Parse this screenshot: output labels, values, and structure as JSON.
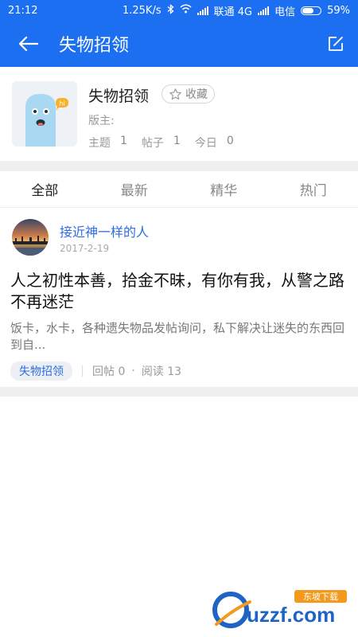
{
  "status_bar": {
    "time": "21:12",
    "speed": "1.25K/s",
    "carrier1": "联通 4G",
    "carrier2": "电信",
    "battery": "59%"
  },
  "app_bar": {
    "title": "失物招领",
    "back_icon": "back-arrow-icon",
    "edit_icon": "edit-post-icon"
  },
  "forum": {
    "name": "失物招领",
    "favorite_label": "收藏",
    "moderator_label": "版主:",
    "stats": [
      {
        "label": "主题",
        "value": "1"
      },
      {
        "label": "帖子",
        "value": "1"
      },
      {
        "label": "今日",
        "value": "0"
      }
    ],
    "mascot_bubble": "hi"
  },
  "tabs": [
    {
      "label": "全部",
      "active": true
    },
    {
      "label": "最新",
      "active": false
    },
    {
      "label": "精华",
      "active": false
    },
    {
      "label": "热门",
      "active": false
    }
  ],
  "post": {
    "author": "接近神一样的人",
    "date": "2017-2-19",
    "title": "人之初性本善，拾金不昧，有你有我，从警之路不再迷茫",
    "excerpt": "饭卡，水卡，各种遗失物品发帖询问，私下解决让迷失的东西回到自...",
    "tag": "失物招领",
    "replies": "回帖 0",
    "reads": "阅读 13"
  },
  "watermark": {
    "text": "uzzf.com",
    "badge": "东坡下载"
  },
  "colors": {
    "primary": "#1d6ff2",
    "link": "#2d6ee0",
    "divider": "#efefef"
  }
}
